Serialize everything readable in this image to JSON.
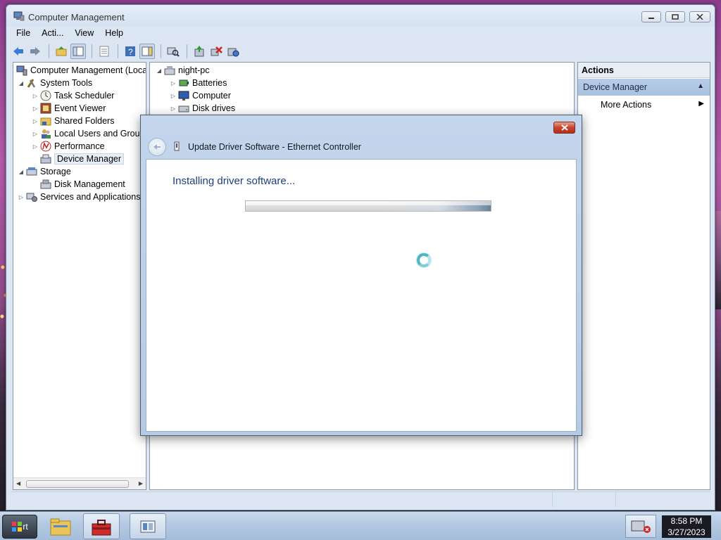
{
  "window": {
    "title": "Computer Management"
  },
  "menubar": [
    "File",
    "Acti...",
    "View",
    "Help"
  ],
  "tree": {
    "root": "Computer Management (Local",
    "system_tools": "System Tools",
    "task_scheduler": "Task Scheduler",
    "event_viewer": "Event Viewer",
    "shared_folders": "Shared Folders",
    "local_users": "Local Users and Group",
    "performance": "Performance",
    "device_manager": "Device Manager",
    "storage": "Storage",
    "disk_management": "Disk Management",
    "services_apps": "Services and Applications"
  },
  "devices": {
    "computer_name": "night-pc",
    "items": [
      "Batteries",
      "Computer",
      "Disk drives"
    ]
  },
  "actions": {
    "header": "Actions",
    "section": "Device Manager",
    "more_actions": "More Actions"
  },
  "dialog": {
    "title": "Update Driver Software - Ethernet Controller",
    "heading": "Installing driver software...",
    "progress_state": "indeterminate"
  },
  "taskbar": {
    "start_label": "rt",
    "time": "8:58 PM",
    "date": "3/27/2023"
  },
  "colors": {
    "dialog_heading": "#1e3e7a",
    "close_button": "#c9432b",
    "selection": "#e8eef6"
  }
}
